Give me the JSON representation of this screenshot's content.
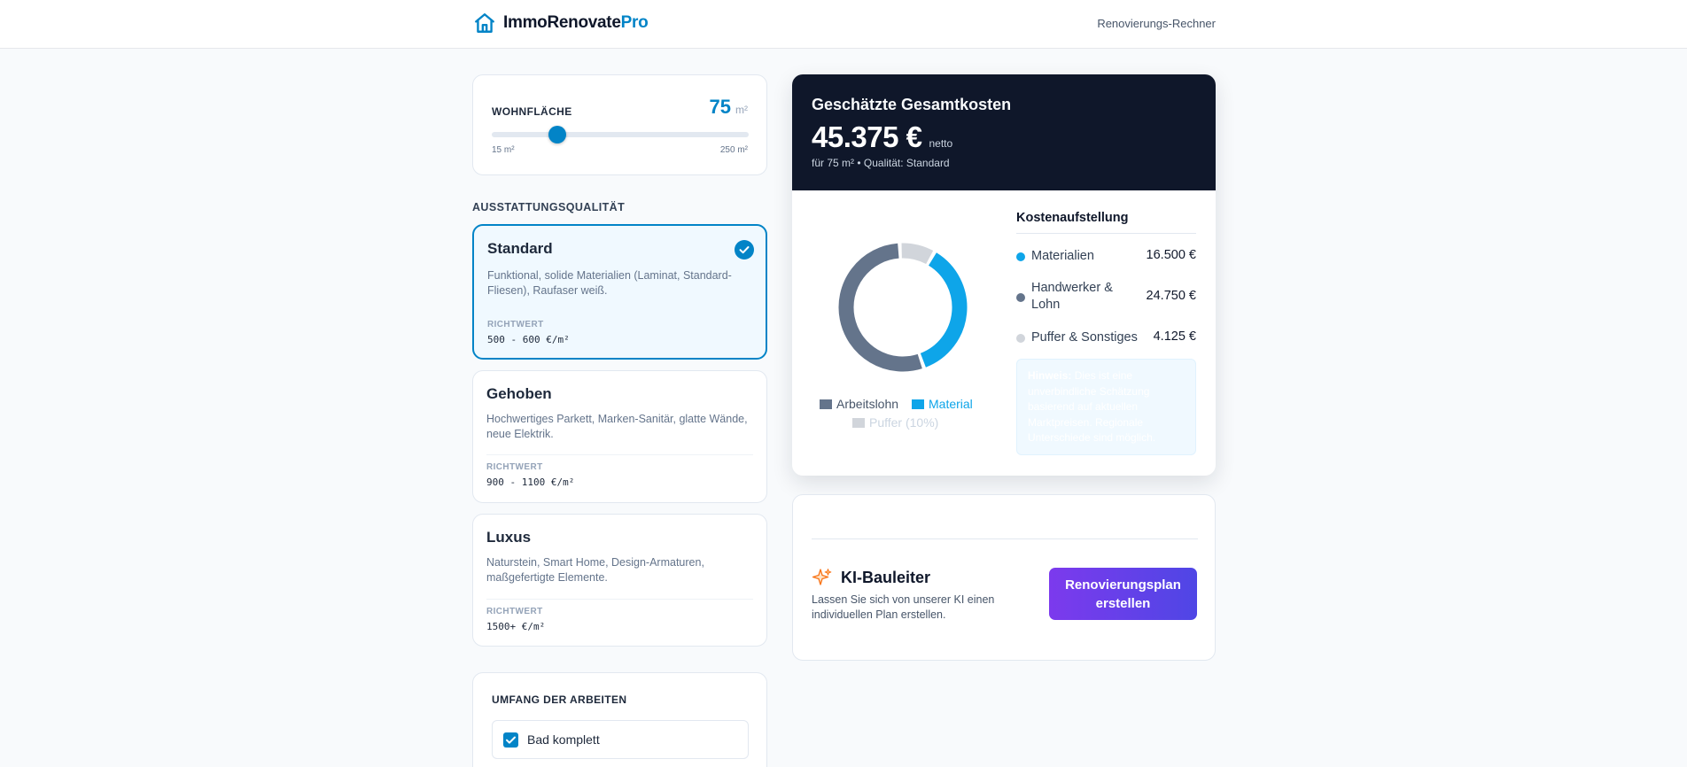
{
  "header": {
    "brand_main": "ImmoRenovate",
    "brand_accent": "Pro",
    "brand_icon": "house-icon",
    "nav_link": "Renovierungs-Rechner"
  },
  "area": {
    "label": "WOHNFLÄCHE",
    "value": "75",
    "unit": "m²",
    "slider_value": 75,
    "min_label": "15 m²",
    "max_label": "250 m²",
    "min": 15,
    "max": 250
  },
  "quality": {
    "heading": "AUSSTATTUNGSQUALITÄT",
    "options": [
      {
        "title": "Standard",
        "description": "Funktional, solide Materialien (Laminat, Standard-Fliesen), Raufaser weiß.",
        "range_label": "RICHTWERT",
        "range": "500 - 600 €/m²",
        "selected": true
      },
      {
        "title": "Gehoben",
        "description": "Hochwertiges Parkett, Marken-Sanitär, glatte Wände, neue Elektrik.",
        "range_label": "RICHTWERT",
        "range": "900 - 1100 €/m²",
        "selected": false
      },
      {
        "title": "Luxus",
        "description": "Naturstein, Smart Home, Design-Armaturen, maßgefertigte Elemente.",
        "range_label": "RICHTWERT",
        "range": "1500+ €/m²",
        "selected": false
      }
    ]
  },
  "scope": {
    "heading": "UMFANG DER ARBEITEN",
    "items": [
      {
        "label": "Bad komplett",
        "checked": true
      }
    ]
  },
  "summary": {
    "title": "Geschätzte Gesamtkosten",
    "amount": "45.375 €",
    "amount_suffix": "netto",
    "subtitle": "für 75 m² • Qualität: Standard",
    "breakdown_title": "Kostenaufstellung",
    "items": [
      {
        "label": "Materialien",
        "value": "16.500 €",
        "color": "#0ea5e9"
      },
      {
        "label": "Handwerker & Lohn",
        "value": "24.750 €",
        "color": "#64748b"
      },
      {
        "label": "Puffer & Sonstiges",
        "value": "4.125 €",
        "color": "#d1d5db"
      }
    ],
    "hint_strong": "Hinweis:",
    "hint_text": "Dies ist eine unverbindliche Schätzung basierend auf aktuellen Marktpreisen. Regionale Unterschiede sind möglich."
  },
  "chart_data": {
    "type": "pie",
    "title": "",
    "categories": [
      "Material",
      "Arbeitslohn",
      "Puffer (10%)"
    ],
    "values": [
      16500,
      24750,
      4125
    ],
    "colors": [
      "#0ea5e9",
      "#64748b",
      "#d1d5db"
    ],
    "legend": [
      "Arbeitslohn",
      "Material",
      "Puffer (10%)"
    ],
    "legend_position": "bottom"
  },
  "ai": {
    "icon": "sparkles-icon",
    "title": "KI-Bauleiter",
    "description": "Lassen Sie sich von unserer KI einen individuellen Plan erstellen.",
    "button_label": "Renovierungsplan erstellen"
  }
}
